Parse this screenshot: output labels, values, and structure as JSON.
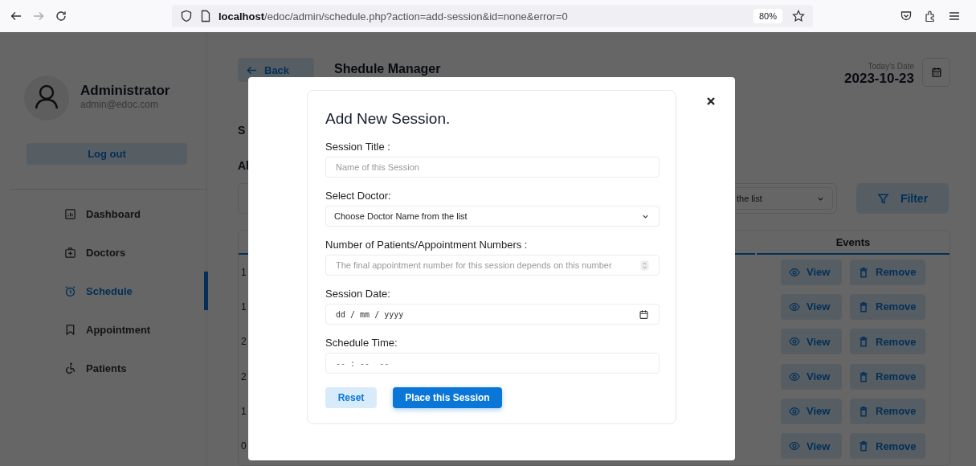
{
  "browser": {
    "url_host": "localhost",
    "url_path": "/edoc/admin/schedule.php?action=add-session&id=none&error=0",
    "zoom": "80%"
  },
  "sidebar": {
    "user_name": "Administrator",
    "user_email": "admin@edoc.com",
    "logout": "Log out",
    "items": [
      {
        "label": "Dashboard",
        "kind": "dashboard",
        "selected": false
      },
      {
        "label": "Doctors",
        "kind": "doctors",
        "selected": false
      },
      {
        "label": "Schedule",
        "kind": "schedule",
        "selected": true
      },
      {
        "label": "Appointment",
        "kind": "appointment",
        "selected": false
      },
      {
        "label": "Patients",
        "kind": "patients",
        "selected": false
      }
    ]
  },
  "header": {
    "back": "Back",
    "title": "Shedule Manager",
    "date_label": "Today's Date",
    "date": "2023-10-23"
  },
  "section_title": "S",
  "list_heading": "Al",
  "filter": {
    "select_value": "the list",
    "button": "Filter"
  },
  "table": {
    "column_header": "Events",
    "rows": [
      {
        "cell": "1",
        "actions": [
          "View",
          "Remove"
        ]
      },
      {
        "cell": "1",
        "actions": [
          "View",
          "Remove"
        ]
      },
      {
        "cell": "2",
        "actions": [
          "View",
          "Remove"
        ]
      },
      {
        "cell": "2",
        "actions": [
          "View",
          "Remove"
        ]
      },
      {
        "cell": "1",
        "actions": [
          "View",
          "Remove"
        ]
      },
      {
        "cell": "0",
        "actions": [
          "View",
          "Remove"
        ]
      }
    ]
  },
  "modal": {
    "title": "Add New Session.",
    "fields": [
      {
        "label": "Session Title :",
        "kind": "text",
        "placeholder": "Name of this Session"
      },
      {
        "label": "Select Doctor:",
        "kind": "select",
        "value": "Choose Doctor Name from the list"
      },
      {
        "label": "Number of Patients/Appointment Numbers :",
        "kind": "number",
        "placeholder": "The final appointment number for this session depends on this number"
      },
      {
        "label": "Session Date:",
        "kind": "date",
        "placeholder": "dd / mm / yyyy"
      },
      {
        "label": "Schedule Time:",
        "kind": "time",
        "placeholder": "-- : --  --"
      }
    ],
    "buttons": [
      {
        "label": "Reset",
        "kind": "secondary"
      },
      {
        "label": "Place this Session",
        "kind": "primary"
      }
    ]
  }
}
